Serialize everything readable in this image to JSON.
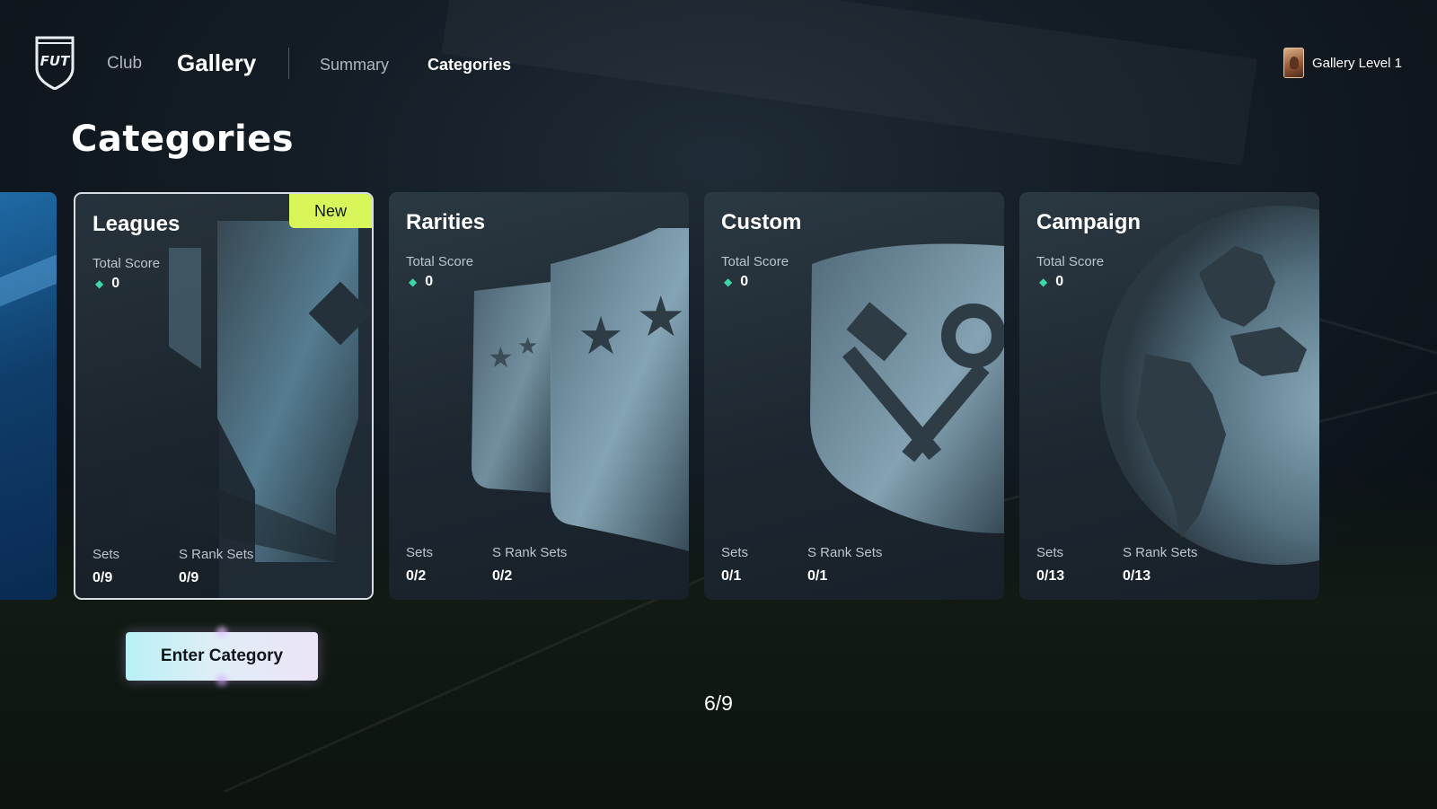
{
  "nav": {
    "club_label": "Club",
    "gallery_label": "Gallery",
    "summary_label": "Summary",
    "categories_label": "Categories",
    "logo_text": "FUT"
  },
  "profile": {
    "gallery_level": "Gallery Level 1"
  },
  "page": {
    "title": "Categories",
    "pager": "6/9"
  },
  "cards": [
    {
      "title": "Leagues",
      "badge": "New",
      "total_score_label": "Total Score",
      "total_score": "0",
      "sets_label": "Sets",
      "sets_value": "0/9",
      "s_rank_label": "S Rank Sets",
      "s_rank_value": "0/9",
      "icon": "trophy-icon",
      "selected": true
    },
    {
      "title": "Rarities",
      "total_score_label": "Total Score",
      "total_score": "0",
      "sets_label": "Sets",
      "sets_value": "0/2",
      "s_rank_label": "S Rank Sets",
      "s_rank_value": "0/2",
      "icon": "star-cards-icon"
    },
    {
      "title": "Custom",
      "total_score_label": "Total Score",
      "total_score": "0",
      "sets_label": "Sets",
      "sets_value": "0/1",
      "s_rank_label": "S Rank Sets",
      "s_rank_value": "0/1",
      "icon": "hammer-wrench-icon"
    },
    {
      "title": "Campaign",
      "total_score_label": "Total Score",
      "total_score": "0",
      "sets_label": "Sets",
      "sets_value": "0/13",
      "s_rank_label": "S Rank Sets",
      "s_rank_value": "0/13",
      "icon": "globe-icon"
    }
  ],
  "actions": {
    "enter_category": "Enter Category"
  },
  "colors": {
    "badge": "#d8f55a",
    "score_icon": "#3fd6a6",
    "selected_border": "#d7dde3"
  }
}
